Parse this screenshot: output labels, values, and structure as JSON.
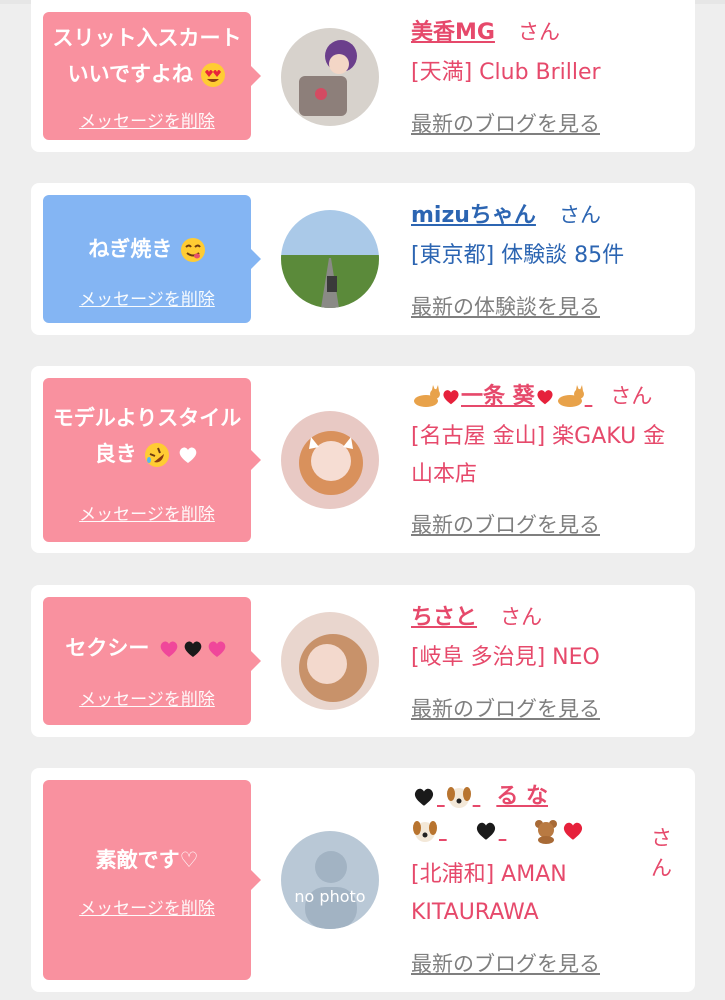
{
  "cards": [
    {
      "message": "スリット入スカートいいですよね",
      "delete_label": "メッセージを削除",
      "name": "美香MG",
      "san": "さん",
      "shop": "[天満] Club Briller",
      "blog": "最新のブログを見る"
    },
    {
      "message": "ねぎ焼き",
      "delete_label": "メッセージを削除",
      "name": "mizuちゃん",
      "san": "さん",
      "shop": "[東京都] 体験談 85件",
      "blog": "最新の体験談を見る"
    },
    {
      "message": "モデルよりスタイル良き",
      "delete_label": "メッセージを削除",
      "name": "一条 葵",
      "san": "さん",
      "shop": "[名古屋 金山] 楽GAKU 金山本店",
      "blog": "最新のブログを見る"
    },
    {
      "message": "セクシー",
      "delete_label": "メッセージを削除",
      "name": "ちさと",
      "san": "さん",
      "shop": "[岐阜 多治見] NEO",
      "blog": "最新のブログを見る"
    },
    {
      "message": "素敵です♡",
      "delete_label": "メッセージを削除",
      "name_part1": "る な",
      "san": "さん",
      "shop": "[北浦和] AMAN KITAURAWA",
      "blog": "最新のブログを見る",
      "avatar_text": "no photo"
    }
  ],
  "colors": {
    "pink_bubble": "#f9919f",
    "blue_bubble": "#84b5f3",
    "pink_text": "#e6496b",
    "blue_text": "#2c65b2",
    "gray_link": "#7f7f7f"
  }
}
